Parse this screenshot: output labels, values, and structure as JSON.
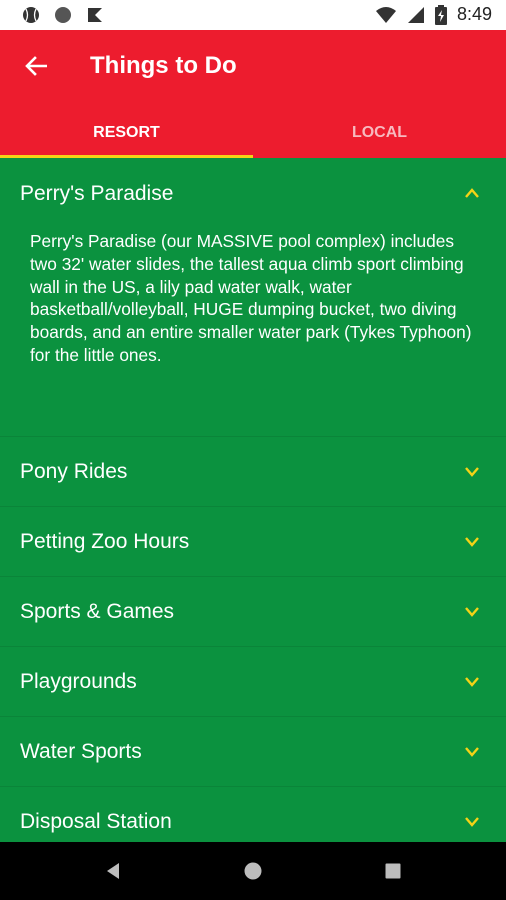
{
  "status_bar": {
    "time": "8:49"
  },
  "header": {
    "title": "Things to Do",
    "back_icon": "arrow-left-icon"
  },
  "tabs": [
    {
      "label": "RESORT",
      "active": true
    },
    {
      "label": "LOCAL",
      "active": false
    }
  ],
  "colors": {
    "app_bar": "#ed1c2e",
    "content_bg": "#0b923f",
    "accent": "#f5d316"
  },
  "sections": [
    {
      "title": "Perry's Paradise",
      "expanded": true,
      "body": "Perry's Paradise (our MASSIVE pool complex) includes two 32' water slides, the tallest aqua climb sport climbing wall in the US, a lily pad water walk, water basketball/volleyball, HUGE dumping bucket, two diving boards, and an entire smaller water park (Tykes Typhoon) for the little ones."
    },
    {
      "title": "Pony Rides",
      "expanded": false
    },
    {
      "title": "Petting Zoo Hours",
      "expanded": false
    },
    {
      "title": "Sports & Games",
      "expanded": false
    },
    {
      "title": "Playgrounds",
      "expanded": false
    },
    {
      "title": "Water Sports",
      "expanded": false
    },
    {
      "title": "Disposal Station",
      "expanded": false
    }
  ]
}
